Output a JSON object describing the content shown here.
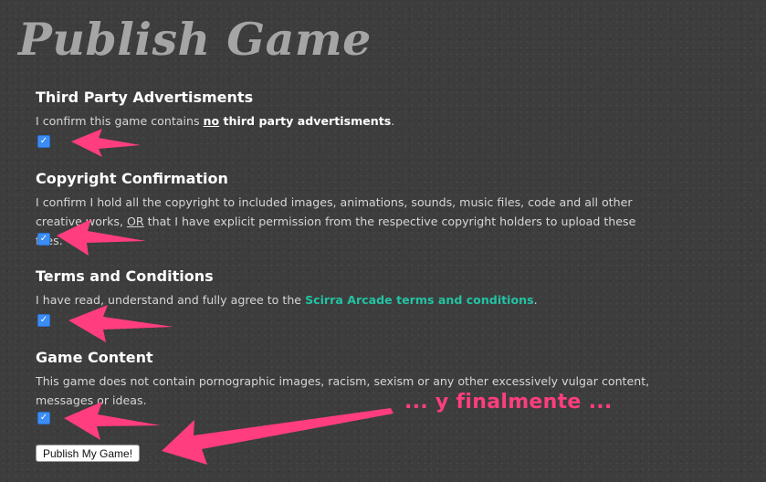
{
  "page": {
    "title": "Publish Game"
  },
  "sections": [
    {
      "heading": "Third Party Advertisments",
      "text_parts": [
        "I confirm this game contains ",
        "no",
        " third party advertisments",
        "."
      ],
      "checked": true
    },
    {
      "heading": "Copyright Confirmation",
      "text_parts": [
        "I confirm I hold all the copyright to included images, animations, sounds, music files, code and all other creative works, ",
        "OR",
        " that I have explicit permission from the respective copyright holders to upload these files."
      ],
      "checked": true
    },
    {
      "heading": "Terms and Conditions",
      "text_parts": [
        "I have read, understand and fully agree to the ",
        "Scirra Arcade terms and conditions",
        "."
      ],
      "checked": true
    },
    {
      "heading": "Game Content",
      "text_parts": [
        "This game does not contain pornographic images, racism, sexism or any other excessively vulgar content, messages or ideas."
      ],
      "checked": true
    }
  ],
  "submit": {
    "label": "Publish My Game!"
  },
  "annotation": {
    "text": "... y finalmente ..."
  },
  "colors": {
    "arrow": "#ff3d7f",
    "link": "#22c3a3",
    "checkbox": "#3b8df5",
    "background": "#3d3d3d"
  },
  "icons": {
    "checkbox": "checkmark-icon",
    "pointer": "arrow-annotation-icon"
  }
}
